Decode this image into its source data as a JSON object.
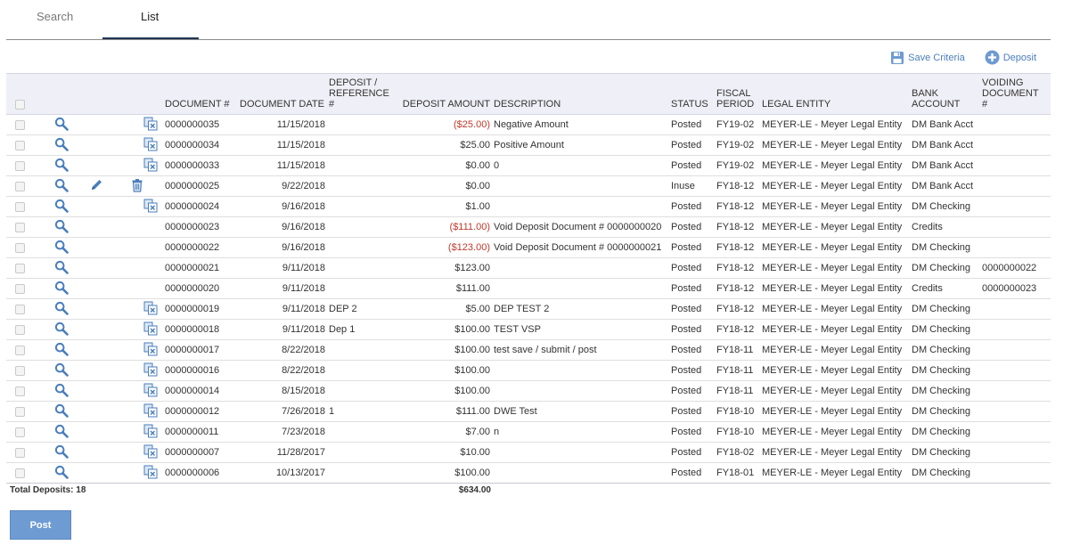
{
  "tabs": {
    "search": "Search",
    "list": "List"
  },
  "toolbar": {
    "save_criteria": "Save Criteria",
    "deposit": "Deposit"
  },
  "headers": {
    "document": "DOCUMENT #",
    "document_date": "DOCUMENT DATE",
    "reference_line1": "DEPOSIT /",
    "reference_line2": "REFERENCE",
    "reference_line3": "#",
    "amount": "DEPOSIT AMOUNT",
    "description": "DESCRIPTION",
    "status": "STATUS",
    "fiscal_line1": "FISCAL",
    "fiscal_line2": "PERIOD",
    "legal_entity": "LEGAL ENTITY",
    "bank_line1": "BANK",
    "bank_line2": "ACCOUNT",
    "voiding_line1": "VOIDING",
    "voiding_line2": "DOCUMENT",
    "voiding_line3": "#"
  },
  "rows": [
    {
      "doc": "0000000035",
      "date": "11/15/2018",
      "ref": "",
      "amount": "($25.00)",
      "negative": true,
      "desc": "Negative Amount",
      "status": "Posted",
      "fiscal": "FY19-02",
      "entity": "MEYER-LE - Meyer Legal Entity",
      "bank": "DM Bank Acct",
      "voiding": "",
      "actions": "view-copy"
    },
    {
      "doc": "0000000034",
      "date": "11/15/2018",
      "ref": "",
      "amount": "$25.00",
      "negative": false,
      "desc": "Positive Amount",
      "status": "Posted",
      "fiscal": "FY19-02",
      "entity": "MEYER-LE - Meyer Legal Entity",
      "bank": "DM Bank Acct",
      "voiding": "",
      "actions": "view-copy"
    },
    {
      "doc": "0000000033",
      "date": "11/15/2018",
      "ref": "",
      "amount": "$0.00",
      "negative": false,
      "desc": "0",
      "status": "Posted",
      "fiscal": "FY19-02",
      "entity": "MEYER-LE - Meyer Legal Entity",
      "bank": "DM Bank Acct",
      "voiding": "",
      "actions": "view-copy"
    },
    {
      "doc": "0000000025",
      "date": "9/22/2018",
      "ref": "",
      "amount": "$0.00",
      "negative": false,
      "desc": "",
      "status": "Inuse",
      "fiscal": "FY18-12",
      "entity": "MEYER-LE - Meyer Legal Entity",
      "bank": "DM Bank Acct",
      "voiding": "",
      "actions": "view-edit-delete"
    },
    {
      "doc": "0000000024",
      "date": "9/16/2018",
      "ref": "",
      "amount": "$1.00",
      "negative": false,
      "desc": "",
      "status": "Posted",
      "fiscal": "FY18-12",
      "entity": "MEYER-LE - Meyer Legal Entity",
      "bank": "DM Checking",
      "voiding": "",
      "actions": "view-copy"
    },
    {
      "doc": "0000000023",
      "date": "9/16/2018",
      "ref": "",
      "amount": "($111.00)",
      "negative": true,
      "desc": "Void Deposit Document # 0000000020",
      "status": "Posted",
      "fiscal": "FY18-12",
      "entity": "MEYER-LE - Meyer Legal Entity",
      "bank": "Credits",
      "voiding": "",
      "actions": "view"
    },
    {
      "doc": "0000000022",
      "date": "9/16/2018",
      "ref": "",
      "amount": "($123.00)",
      "negative": true,
      "desc": "Void Deposit Document # 0000000021",
      "status": "Posted",
      "fiscal": "FY18-12",
      "entity": "MEYER-LE - Meyer Legal Entity",
      "bank": "DM Checking",
      "voiding": "",
      "actions": "view"
    },
    {
      "doc": "0000000021",
      "date": "9/11/2018",
      "ref": "",
      "amount": "$123.00",
      "negative": false,
      "desc": "",
      "status": "Posted",
      "fiscal": "FY18-12",
      "entity": "MEYER-LE - Meyer Legal Entity",
      "bank": "DM Checking",
      "voiding": "0000000022",
      "actions": "view"
    },
    {
      "doc": "0000000020",
      "date": "9/11/2018",
      "ref": "",
      "amount": "$111.00",
      "negative": false,
      "desc": "",
      "status": "Posted",
      "fiscal": "FY18-12",
      "entity": "MEYER-LE - Meyer Legal Entity",
      "bank": "Credits",
      "voiding": "0000000023",
      "actions": "view"
    },
    {
      "doc": "0000000019",
      "date": "9/11/2018",
      "ref": "DEP 2",
      "amount": "$5.00",
      "negative": false,
      "desc": "DEP TEST 2",
      "status": "Posted",
      "fiscal": "FY18-12",
      "entity": "MEYER-LE - Meyer Legal Entity",
      "bank": "DM Checking",
      "voiding": "",
      "actions": "view-copy"
    },
    {
      "doc": "0000000018",
      "date": "9/11/2018",
      "ref": "Dep 1",
      "amount": "$100.00",
      "negative": false,
      "desc": "TEST VSP",
      "status": "Posted",
      "fiscal": "FY18-12",
      "entity": "MEYER-LE - Meyer Legal Entity",
      "bank": "DM Checking",
      "voiding": "",
      "actions": "view-copy"
    },
    {
      "doc": "0000000017",
      "date": "8/22/2018",
      "ref": "",
      "amount": "$100.00",
      "negative": false,
      "desc": "test save / submit / post",
      "status": "Posted",
      "fiscal": "FY18-11",
      "entity": "MEYER-LE - Meyer Legal Entity",
      "bank": "DM Checking",
      "voiding": "",
      "actions": "view-copy"
    },
    {
      "doc": "0000000016",
      "date": "8/22/2018",
      "ref": "",
      "amount": "$100.00",
      "negative": false,
      "desc": "",
      "status": "Posted",
      "fiscal": "FY18-11",
      "entity": "MEYER-LE - Meyer Legal Entity",
      "bank": "DM Checking",
      "voiding": "",
      "actions": "view-copy"
    },
    {
      "doc": "0000000014",
      "date": "8/15/2018",
      "ref": "",
      "amount": "$100.00",
      "negative": false,
      "desc": "",
      "status": "Posted",
      "fiscal": "FY18-11",
      "entity": "MEYER-LE - Meyer Legal Entity",
      "bank": "DM Checking",
      "voiding": "",
      "actions": "view-copy"
    },
    {
      "doc": "0000000012",
      "date": "7/26/2018",
      "ref": "1",
      "amount": "$111.00",
      "negative": false,
      "desc": "DWE Test",
      "status": "Posted",
      "fiscal": "FY18-10",
      "entity": "MEYER-LE - Meyer Legal Entity",
      "bank": "DM Checking",
      "voiding": "",
      "actions": "view-copy"
    },
    {
      "doc": "0000000011",
      "date": "7/23/2018",
      "ref": "",
      "amount": "$7.00",
      "negative": false,
      "desc": "n",
      "status": "Posted",
      "fiscal": "FY18-10",
      "entity": "MEYER-LE - Meyer Legal Entity",
      "bank": "DM Checking",
      "voiding": "",
      "actions": "view-copy"
    },
    {
      "doc": "0000000007",
      "date": "11/28/2017",
      "ref": "",
      "amount": "$10.00",
      "negative": false,
      "desc": "",
      "status": "Posted",
      "fiscal": "FY18-02",
      "entity": "MEYER-LE - Meyer Legal Entity",
      "bank": "DM Checking",
      "voiding": "",
      "actions": "view-copy"
    },
    {
      "doc": "0000000006",
      "date": "10/13/2017",
      "ref": "",
      "amount": "$100.00",
      "negative": false,
      "desc": "",
      "status": "Posted",
      "fiscal": "FY18-01",
      "entity": "MEYER-LE - Meyer Legal Entity",
      "bank": "DM Checking",
      "voiding": "",
      "actions": "view-copy"
    }
  ],
  "footer": {
    "total_label": "Total Deposits: 18",
    "total_amount": "$634.00",
    "post_label": "Post"
  },
  "colors": {
    "accent": "#4a7ebb",
    "negative": "#c0392b",
    "header_bg": "#efeff7",
    "post_button": "#6f9bd3"
  }
}
